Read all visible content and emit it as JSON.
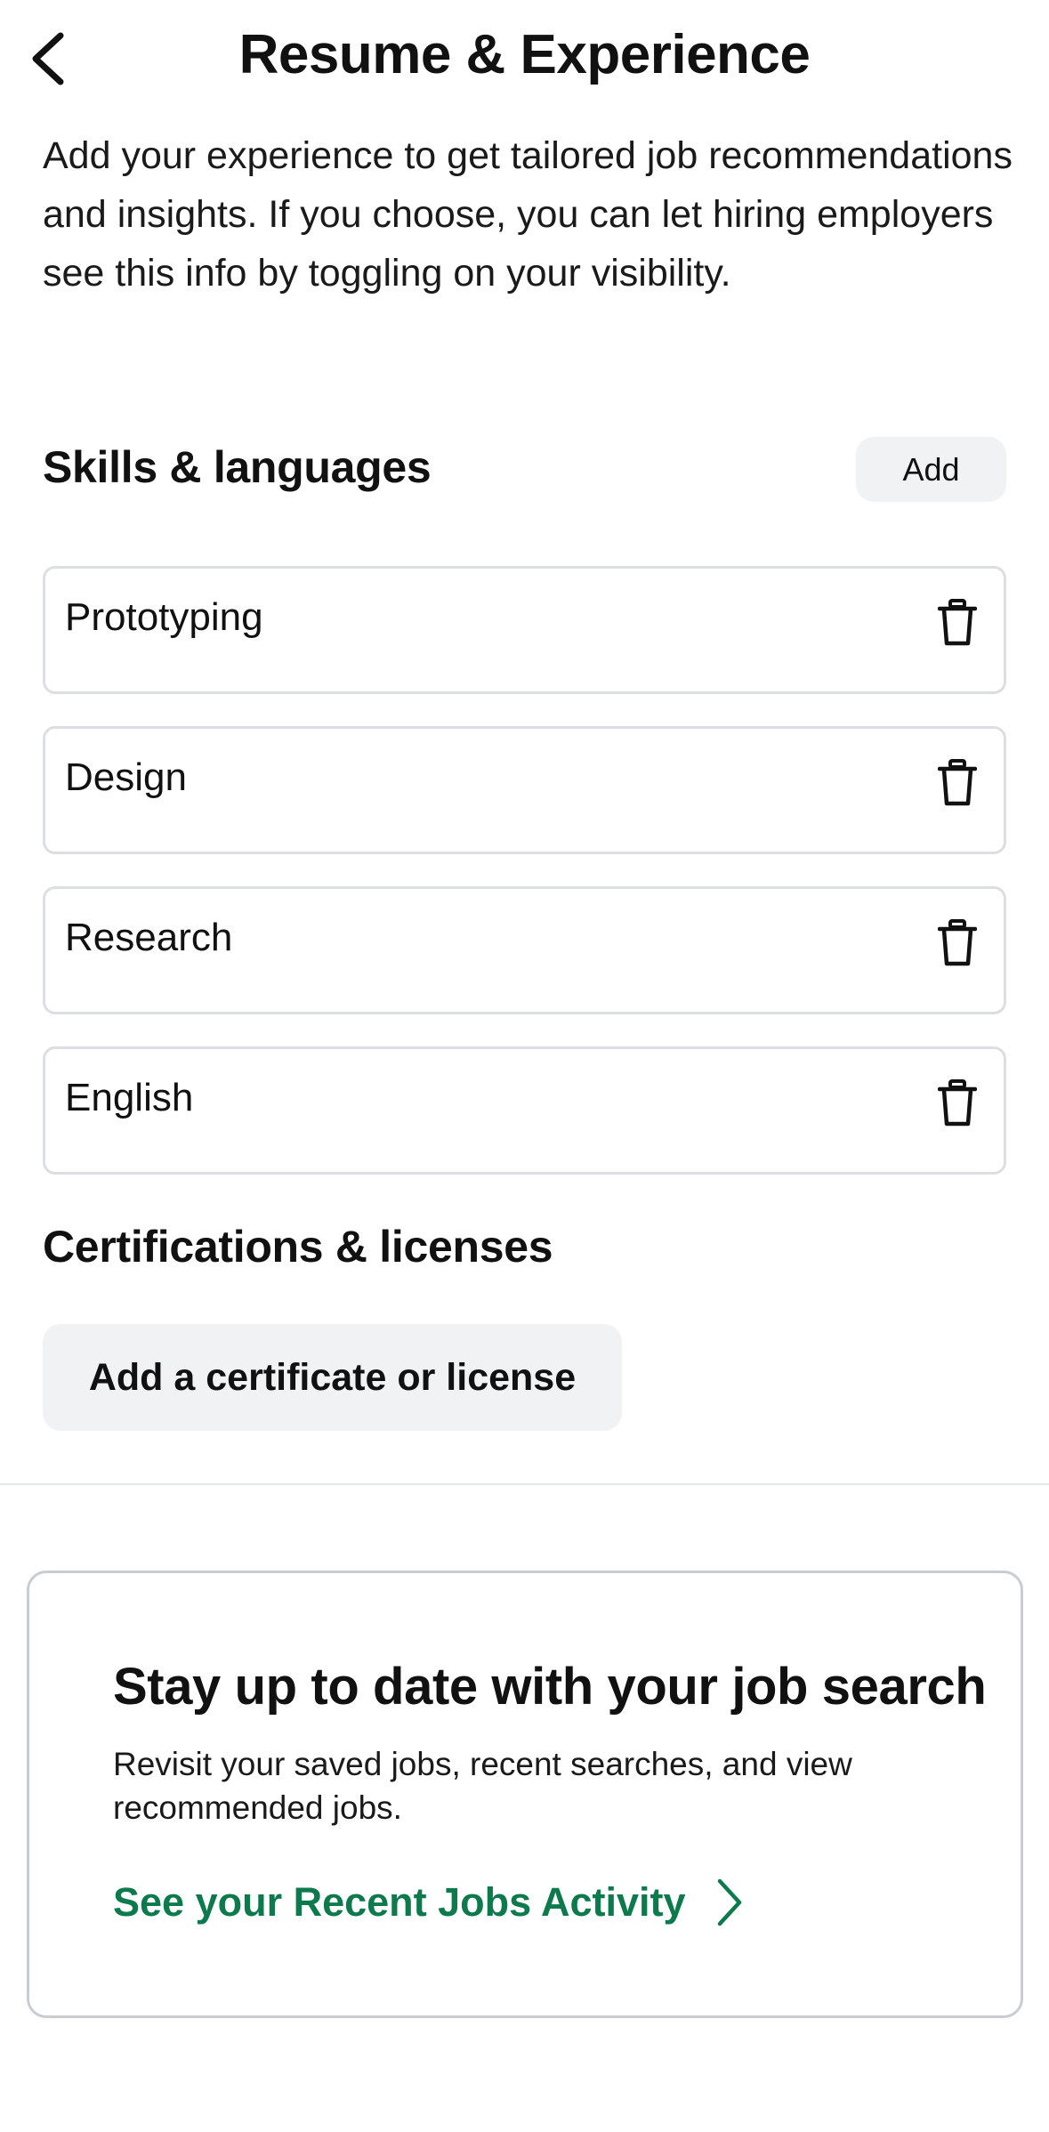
{
  "header": {
    "title": "Resume & Experience",
    "back_icon": "chevron-left-icon"
  },
  "intro": "Add your experience to get tailored job recommendations and insights. If you choose, you can let hiring employers see this info by toggling on your visibility.",
  "skills": {
    "title": "Skills & languages",
    "add_label": "Add",
    "items": [
      {
        "label": "Prototyping",
        "icon": "trash-icon"
      },
      {
        "label": "Design",
        "icon": "trash-icon"
      },
      {
        "label": "Research",
        "icon": "trash-icon"
      },
      {
        "label": "English",
        "icon": "trash-icon"
      }
    ]
  },
  "certifications": {
    "title": "Certifications & licenses",
    "add_label": "Add a certificate or license"
  },
  "promo": {
    "title": "Stay up to date with your job search",
    "description": "Revisit your saved jobs, recent searches, and view recommended jobs.",
    "link_label": "See your Recent Jobs Activity",
    "link_icon": "chevron-right-icon"
  },
  "colors": {
    "link_green": "#0c7a4c",
    "button_bg": "#f1f2f4",
    "card_border": "#dcdee2"
  }
}
